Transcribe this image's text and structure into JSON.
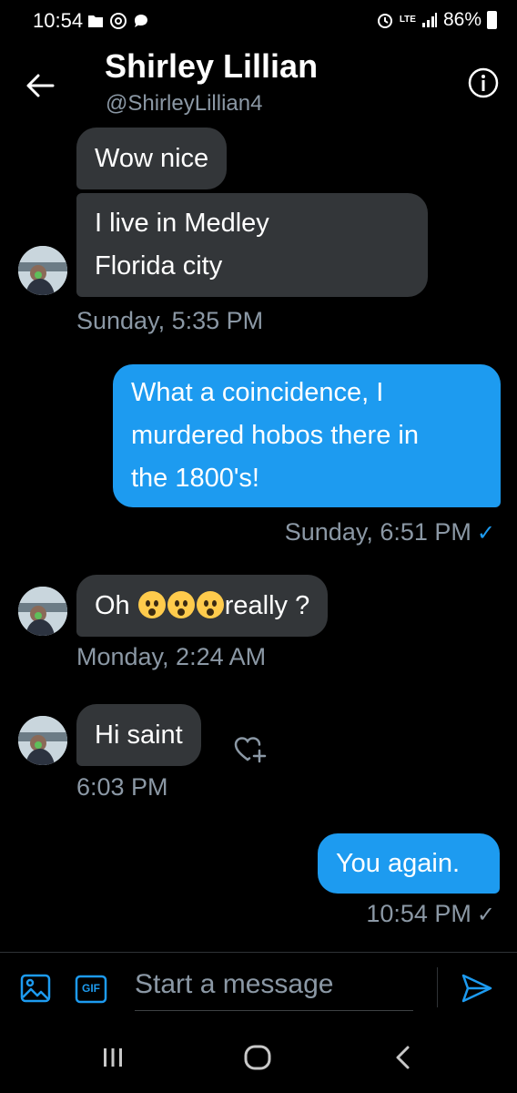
{
  "status_bar": {
    "time": "10:54",
    "network": "LTE",
    "battery": "86%"
  },
  "header": {
    "name": "Shirley Lillian",
    "handle": "@ShirleyLillian4"
  },
  "messages": [
    {
      "text": "Wow nice"
    },
    {
      "line1": "I live in Medley",
      "line2": "Florida city"
    },
    {
      "timestamp": "Sunday, 5:35 PM"
    },
    {
      "line1": "What a coincidence, I",
      "line2": "murdered hobos there in",
      "line3": "the 1800's!"
    },
    {
      "timestamp": "Sunday, 6:51 PM"
    },
    {
      "prefix": "Oh",
      "suffix": "really ?"
    },
    {
      "timestamp": "Monday, 2:24 AM"
    },
    {
      "text": "Hi saint"
    },
    {
      "timestamp": "6:03 PM"
    },
    {
      "text": "You again."
    },
    {
      "timestamp": "10:54 PM"
    }
  ],
  "composer": {
    "placeholder": "Start a message",
    "gif_label": "GIF"
  },
  "colors": {
    "accent": "#1d9bf0",
    "incoming_bubble": "#333639",
    "muted": "#8b98a5"
  }
}
